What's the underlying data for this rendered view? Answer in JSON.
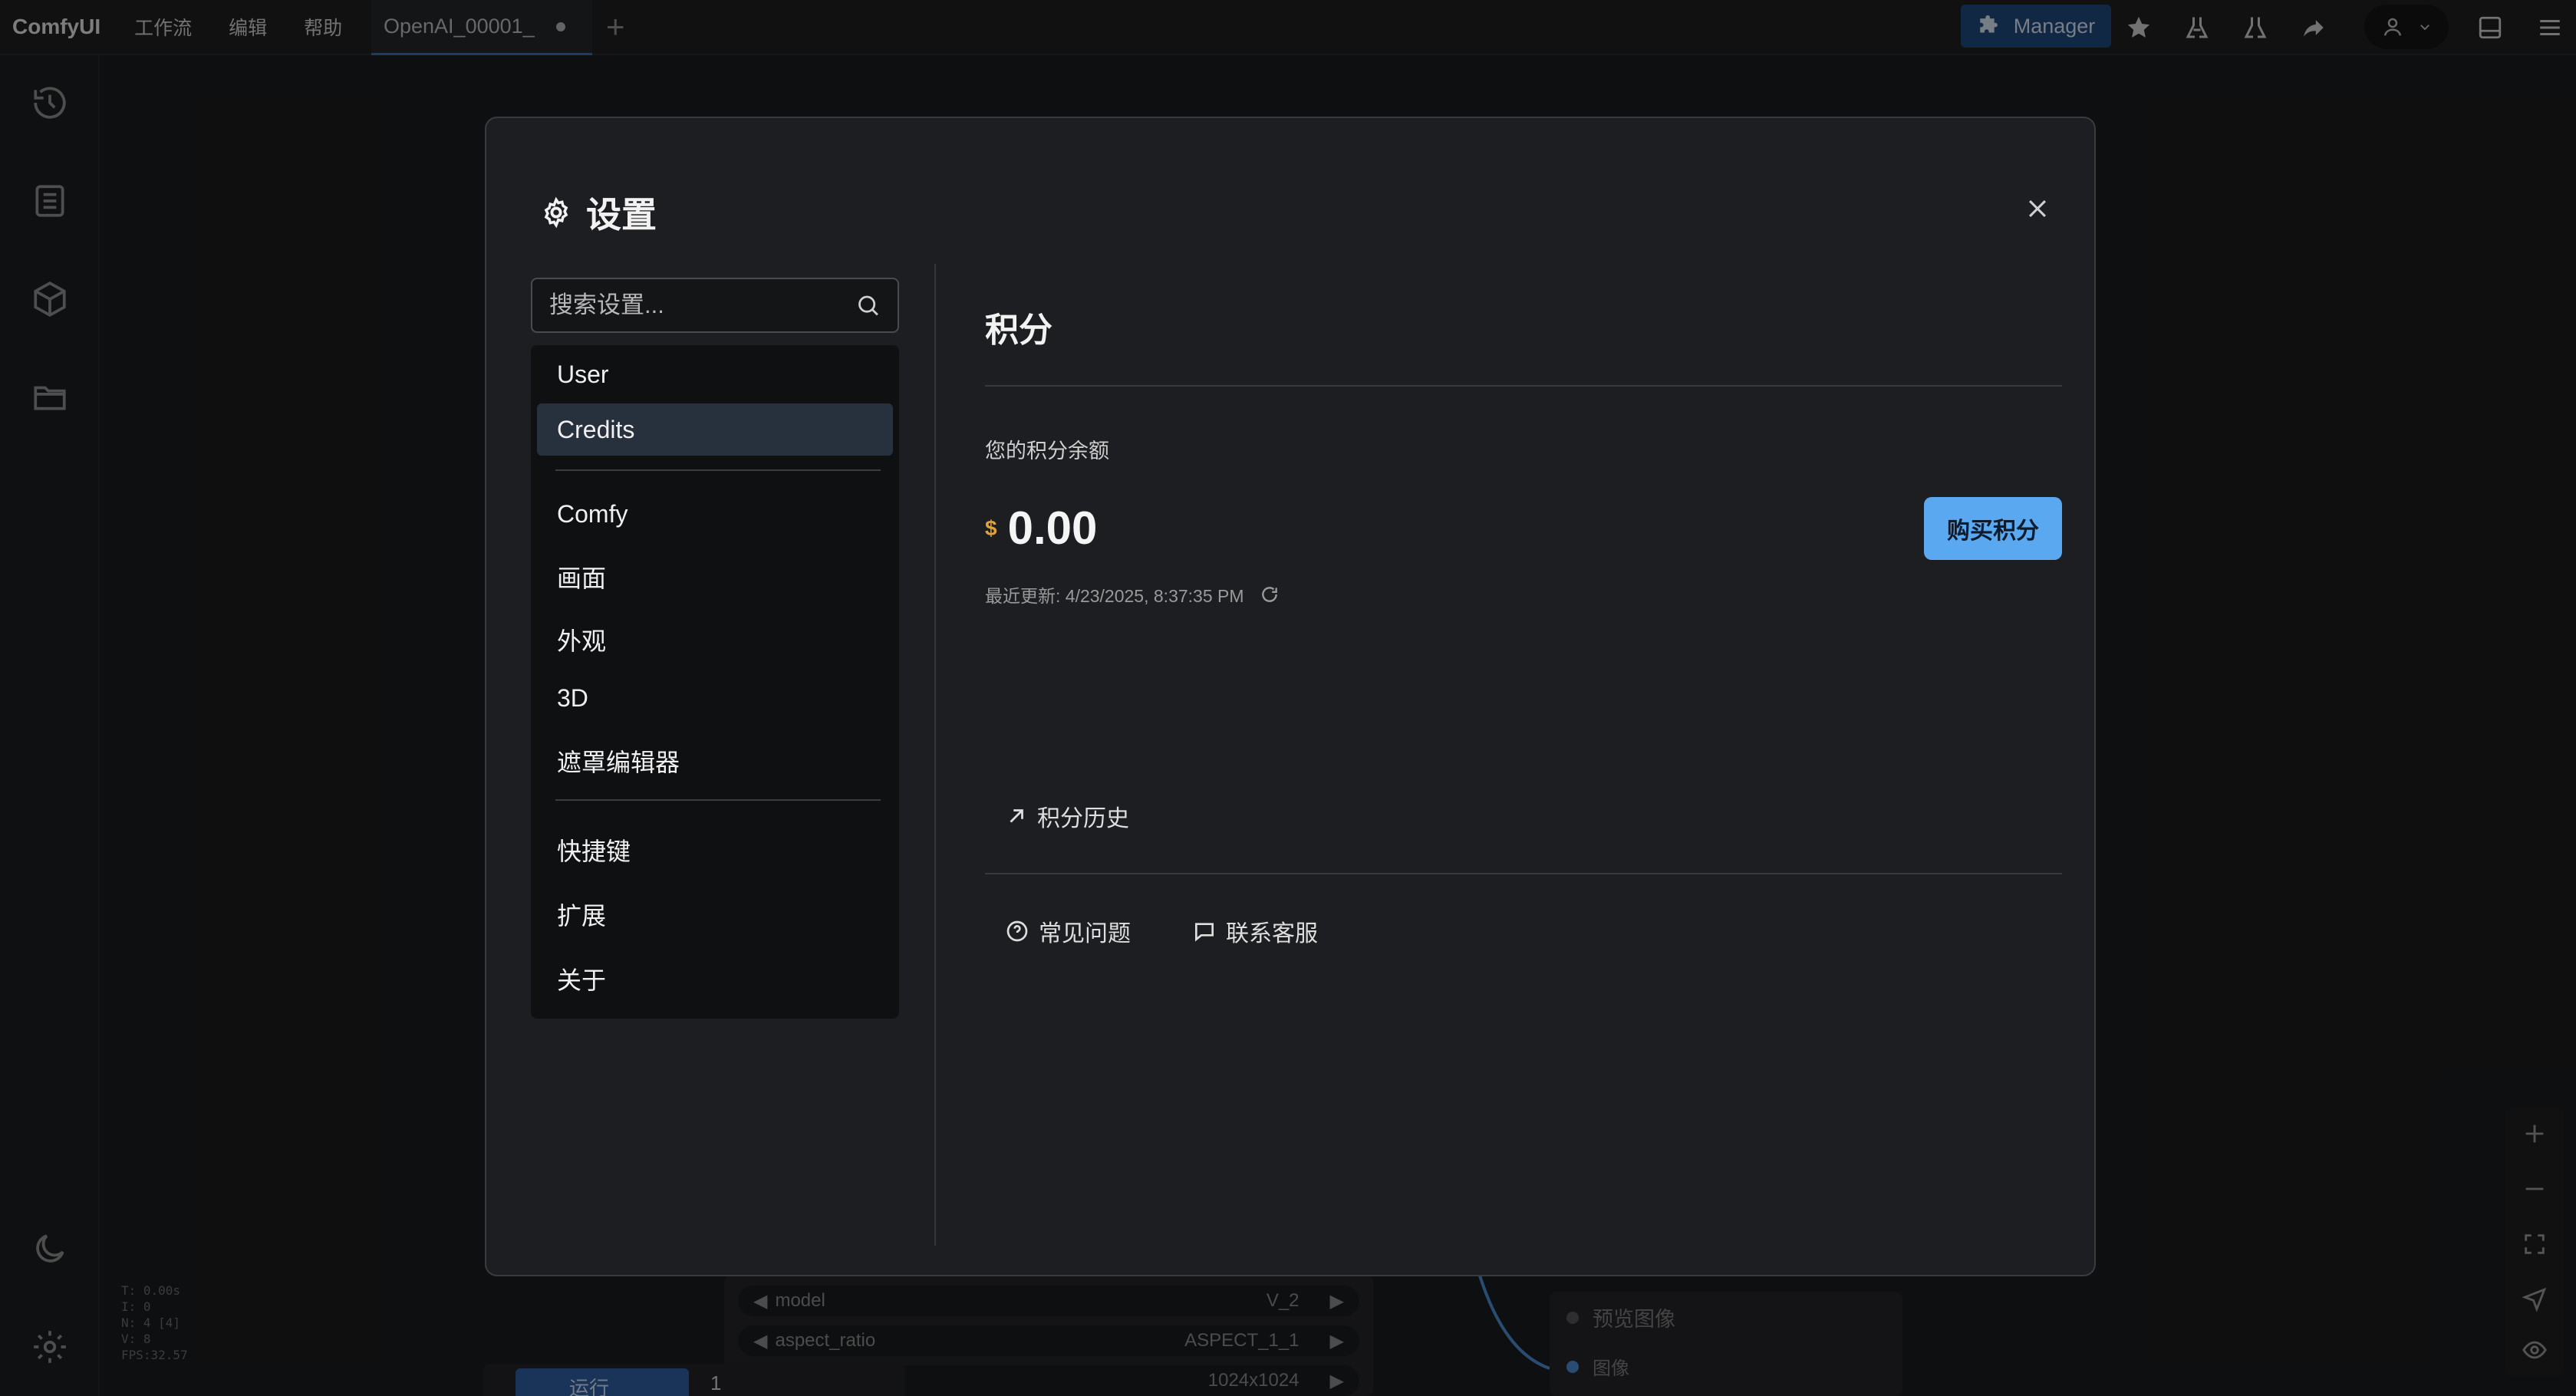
{
  "topbar": {
    "brand": "ComfyUI",
    "menu": [
      "工作流",
      "编辑",
      "帮助"
    ],
    "workflow_tab": "OpenAI_00001_",
    "manager_label": "Manager"
  },
  "canvas": {
    "stats": [
      "T: 0.00s",
      "I: 0",
      "N: 4 [4]",
      "V: 8",
      "FPS:32.57"
    ],
    "widgets": [
      {
        "name": "model",
        "value": "V_2"
      },
      {
        "name": "aspect_ratio",
        "value": "ASPECT_1_1"
      },
      {
        "name": "",
        "value": "1024x1024"
      }
    ],
    "preview_node": {
      "title": "预览图像",
      "input": "图像"
    },
    "run_label": "运行",
    "run_count": "1"
  },
  "dialog": {
    "title": "设置",
    "search_placeholder": "搜索设置...",
    "nav": {
      "group1": [
        "User",
        "Credits"
      ],
      "group2": [
        "Comfy",
        "画面",
        "外观",
        "3D",
        "遮罩编辑器"
      ],
      "group3": [
        "快捷键",
        "扩展",
        "关于"
      ],
      "active": "Credits"
    },
    "credits": {
      "section_title": "积分",
      "balance_label": "您的积分余额",
      "currency_symbol": "$",
      "balance": "0.00",
      "updated": "最近更新: 4/23/2025, 8:37:35 PM",
      "buy_label": "购买积分",
      "history_label": "积分历史",
      "faq_label": "常见问题",
      "support_label": "联系客服"
    }
  },
  "colors": {
    "accent": "#5aa8f0",
    "active_nav": "#27303d",
    "dialog_bg": "#1d1e21"
  }
}
